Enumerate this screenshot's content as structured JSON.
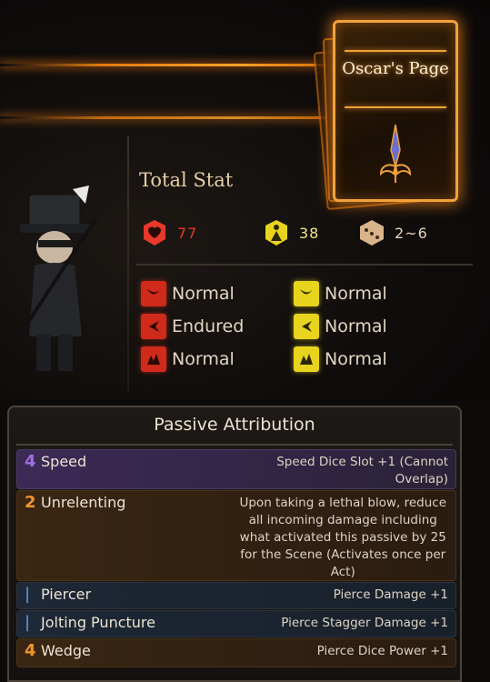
{
  "card": {
    "title": "Oscar's Page"
  },
  "stats": {
    "heading": "Total Stat",
    "hp": "77",
    "stagger": "38",
    "speed": "2~6"
  },
  "resistances": {
    "physical": [
      {
        "icon": "slash-resist-icon",
        "label": "Normal"
      },
      {
        "icon": "pierce-resist-icon",
        "label": "Endured"
      },
      {
        "icon": "blunt-resist-icon",
        "label": "Normal"
      }
    ],
    "stagger": [
      {
        "icon": "slash-stagger-resist-icon",
        "label": "Normal"
      },
      {
        "icon": "pierce-stagger-resist-icon",
        "label": "Normal"
      },
      {
        "icon": "blunt-stagger-resist-icon",
        "label": "Normal"
      }
    ]
  },
  "passives": {
    "title": "Passive Attribution",
    "items": [
      {
        "cost": "4",
        "name": "Speed",
        "desc": "Speed Dice Slot +1 (Cannot\nOverlap)"
      },
      {
        "cost": "2",
        "name": "Unrelenting",
        "desc": "Upon taking a lethal blow, reduce\nall incoming damage including\nwhat activated this passive by 25\nfor the Scene (Activates once per\nAct)"
      },
      {
        "cost": "|",
        "name": "Piercer",
        "desc": "Pierce Damage +1"
      },
      {
        "cost": "|",
        "name": "Jolting Puncture",
        "desc": "Pierce Stagger Damage +1"
      },
      {
        "cost": "4",
        "name": "Wedge",
        "desc": "Pierce Dice Power +1"
      }
    ]
  },
  "colors": {
    "accent": "#f0a23a",
    "hp": "#e8382a",
    "stagger": "#e8d41e",
    "speed": "#d9b48a",
    "rare": "#a070e0",
    "uncommon": "#f0962a",
    "common": "#5aa0e0"
  }
}
